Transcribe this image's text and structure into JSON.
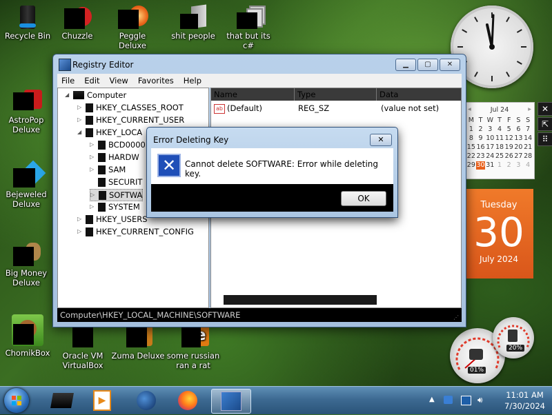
{
  "desktop": {
    "icons": [
      {
        "label_lines": [
          "Recycle Bin"
        ]
      },
      {
        "label_lines": [
          "Chuzzle"
        ]
      },
      {
        "label_lines": [
          "Peggle Deluxe"
        ]
      },
      {
        "label_lines": [
          "shit people"
        ]
      },
      {
        "label_lines": [
          "that but its c#"
        ]
      },
      {
        "label_lines": [
          "AstroPop",
          "Deluxe"
        ]
      },
      {
        "label_lines": [
          "Bejeweled",
          "Deluxe"
        ]
      },
      {
        "label_lines": [
          "Big Money",
          "Deluxe"
        ]
      },
      {
        "label_lines": [
          "ChomikBox"
        ]
      },
      {
        "label_lines": [
          "Oracle VM",
          "VirtualBox"
        ]
      },
      {
        "label_lines": [
          "Zuma Deluxe"
        ]
      },
      {
        "label_lines": [
          "some russian",
          "ran a rat"
        ]
      }
    ]
  },
  "calendar": {
    "month_label": "Jul 24",
    "weekdays": [
      "M",
      "T",
      "W",
      "T",
      "F",
      "S",
      "S"
    ],
    "days": [
      "1",
      "2",
      "3",
      "4",
      "5",
      "6",
      "7",
      "8",
      "9",
      "10",
      "11",
      "12",
      "13",
      "14",
      "15",
      "16",
      "17",
      "18",
      "19",
      "20",
      "21",
      "22",
      "23",
      "24",
      "25",
      "26",
      "27",
      "28",
      "29",
      "30",
      "31",
      "1",
      "2",
      "3",
      "4"
    ],
    "highlighted_day": "30",
    "weekday_full": "Tuesday",
    "big_day": "30",
    "month_year": "July 2024"
  },
  "meters": {
    "cpu_percent": "01%",
    "memory_percent": "20%"
  },
  "registry_window": {
    "title": "Registry Editor",
    "menu": [
      "File",
      "Edit",
      "View",
      "Favorites",
      "Help"
    ],
    "tree": {
      "root": "Computer",
      "items": [
        "HKEY_CLASSES_ROOT",
        "HKEY_CURRENT_USER",
        "HKEY_LOCAL_MACHINE",
        "BCD00000000",
        "HARDWARE",
        "SAM",
        "SECURITY",
        "SOFTWARE",
        "SYSTEM",
        "HKEY_USERS",
        "HKEY_CURRENT_CONFIG"
      ],
      "visible_text": [
        "HKEY_CLASSES_ROOT",
        "HKEY_CURRENT_USER",
        "HKEY_LOCA",
        "BCD0000",
        "HARDW",
        "SAM",
        "SECURIT",
        "SOFTWA",
        "SYSTEM",
        "HKEY_USERS",
        "HKEY_CURRENT_CONFIG"
      ],
      "selected": "SOFTWARE"
    },
    "columns": [
      "Name",
      "Type",
      "Data"
    ],
    "values": [
      {
        "name": "(Default)",
        "type": "REG_SZ",
        "data": "(value not set)",
        "icon": "ab-string-icon"
      }
    ],
    "status_path": "Computer\\HKEY_LOCAL_MACHINE\\SOFTWARE"
  },
  "dialog": {
    "title": "Error Deleting Key",
    "message": "Cannot delete SOFTWARE:  Error while deleting key.",
    "ok_label": "OK",
    "close_label": "✕",
    "icon": "error-x-icon"
  },
  "taskbar": {
    "time": "11:01 AM",
    "date": "7/30/2024",
    "apps": [
      "desktop-app-icon",
      "media-player-icon",
      "internet-explorer-icon",
      "firefox-icon",
      "registry-editor-icon"
    ]
  },
  "colors": {
    "accent_orange": "#e8601c",
    "dialog_error_blue": "#1f4fb8",
    "taskbar": "#3d6a92"
  }
}
